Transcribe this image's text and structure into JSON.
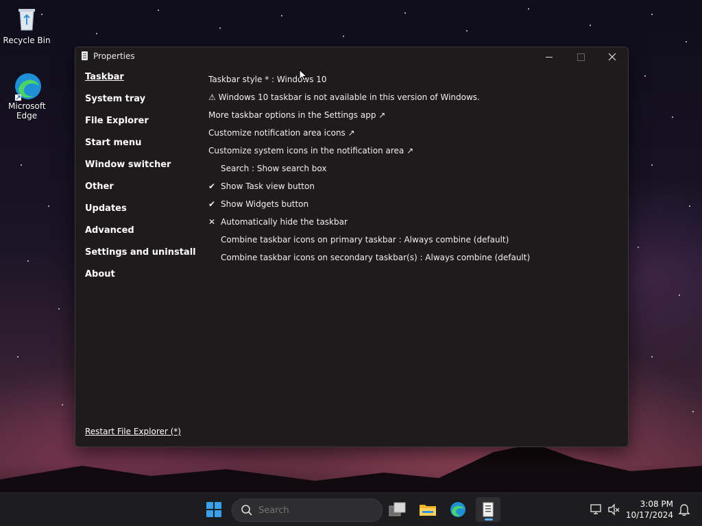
{
  "desktop": {
    "icons": [
      {
        "label": "Recycle Bin"
      },
      {
        "label": "Microsoft Edge"
      }
    ]
  },
  "window": {
    "title": "Properties",
    "nav": [
      {
        "label": "Taskbar",
        "active": true
      },
      {
        "label": "System tray"
      },
      {
        "label": "File Explorer"
      },
      {
        "label": "Start menu"
      },
      {
        "label": "Window switcher"
      },
      {
        "label": "Other"
      },
      {
        "label": "Updates"
      },
      {
        "label": "Advanced"
      },
      {
        "label": "Settings and uninstall"
      },
      {
        "label": "About"
      }
    ],
    "restart_link": "Restart File Explorer (*)",
    "settings": {
      "taskbar_style": "Taskbar style * : Windows 10",
      "warning": "⚠ Windows 10 taskbar is not available in this version of Windows.",
      "more_options": "More taskbar options in the Settings app ↗",
      "notification_icons": "Customize notification area icons ↗",
      "system_icons": "Customize system icons in the notification area ↗",
      "search": "Search : Show search box",
      "task_view": {
        "label": "Show Task view button",
        "mark": "✔"
      },
      "widgets": {
        "label": "Show Widgets button",
        "mark": "✔"
      },
      "auto_hide": {
        "label": "Automatically hide the taskbar",
        "mark": "✕"
      },
      "combine_primary": "Combine taskbar icons on primary taskbar : Always combine (default)",
      "combine_secondary": "Combine taskbar icons on secondary taskbar(s) : Always combine (default)"
    }
  },
  "taskbar": {
    "search_placeholder": "Search",
    "time": "3:08 PM",
    "date": "10/17/2024"
  },
  "colors": {
    "window_bg": "#1f1b1c",
    "taskbar_bg": "#1d1d1f",
    "accent": "#3aa0f0"
  }
}
